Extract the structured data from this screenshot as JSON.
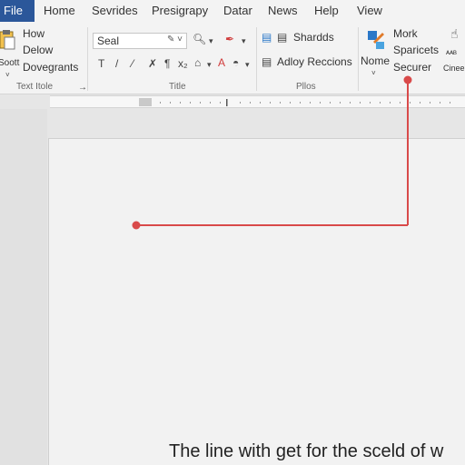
{
  "tabs": [
    {
      "label": "File"
    },
    {
      "label": "Home"
    },
    {
      "label": "Sevrides"
    },
    {
      "label": "Presigrapy"
    },
    {
      "label": "Datar"
    },
    {
      "label": "News"
    },
    {
      "label": "Help"
    },
    {
      "label": "View"
    }
  ],
  "clipboard": {
    "paste_label": "Soott",
    "items": [
      "How",
      "Delow",
      "Dovegrants"
    ],
    "group_label": "Text Itole"
  },
  "font": {
    "name": "Seal",
    "group_label": "Title"
  },
  "styles": {
    "items": [
      "Shardds",
      "Adloy Reccions"
    ],
    "group_label": "Pllos"
  },
  "editing": {
    "none_label": "Nome",
    "items": [
      "Mork",
      "Sparicets",
      "Securer"
    ],
    "right_small_1": "ᴬᴬᴮ",
    "right_small_2": "Cinee"
  },
  "document": {
    "text": "The line with get for the sceld of w"
  },
  "colors": {
    "file_tab": "#2b579a",
    "callout_line": "#d94a4a"
  }
}
